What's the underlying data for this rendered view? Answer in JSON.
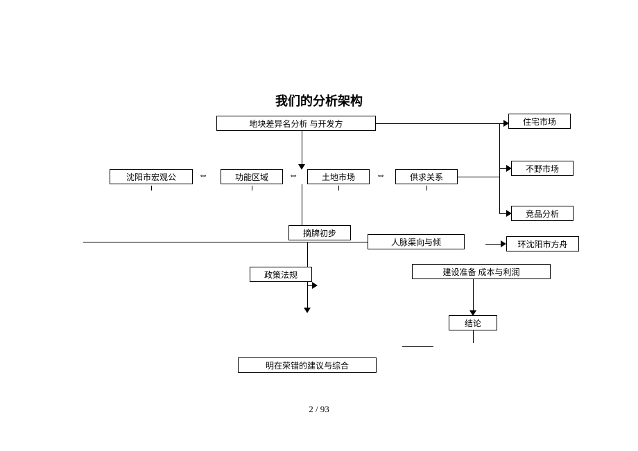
{
  "title": "我们的分析架构",
  "footer": "2 / 93",
  "boxes": {
    "b1": "地块差异名分析    与开发方",
    "b2": "住宅市场",
    "b3": "沈阳市宏观公",
    "b4": "功能区域",
    "b5": "土地市场",
    "b6": "供求关系",
    "b7": "不野市场",
    "b8": "竞品分析",
    "b9": "摘牌初步",
    "b10": "人脉渠向与倾",
    "b11": "环沈阳市方舟",
    "b12": "政策法规",
    "b13": "建设准备    成本与利润",
    "b14": "结论",
    "b15": "明在荣错的建议与综合"
  }
}
